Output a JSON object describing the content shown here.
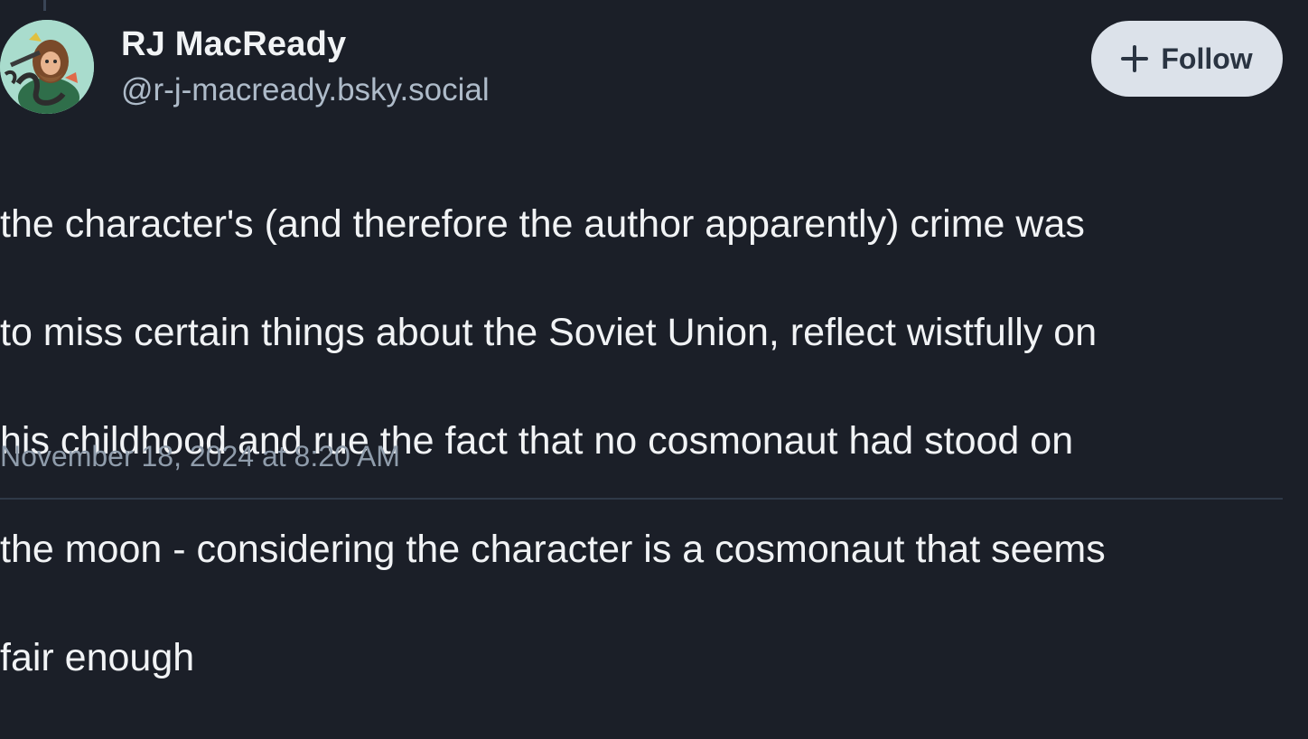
{
  "post": {
    "author": {
      "display_name": "RJ MacReady",
      "handle": "@r-j-macready.bsky.social"
    },
    "follow_button": {
      "label": "Follow",
      "icon": "plus-icon"
    },
    "text_lines": [
      "the character's (and therefore the author apparently) crime was",
      "to miss certain things about the Soviet Union, reflect wistfully on",
      "his childhood and rue the fact that no cosmonaut had stood on",
      "the moon - considering the character is a cosmonaut that seems",
      "fair enough"
    ],
    "timestamp": "November 18, 2024 at 8:20 AM"
  },
  "colors": {
    "background": "#1b1f28",
    "follow_button_bg": "#dce2ea",
    "handle_text": "#aebbc9",
    "timestamp_text": "#8f9cab"
  }
}
